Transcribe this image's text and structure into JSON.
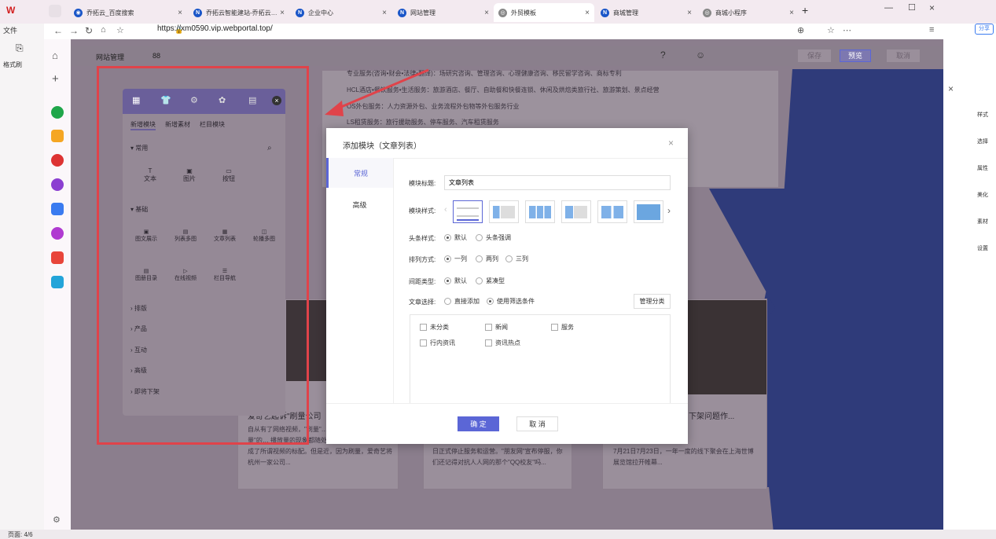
{
  "browser": {
    "tabs": [
      {
        "label": "乔拓云_百度搜索"
      },
      {
        "label": "乔拓云智能建站-乔拓云…"
      },
      {
        "label": "企业中心"
      },
      {
        "label": "网站管理"
      },
      {
        "label": "外贸模板"
      },
      {
        "label": "商城管理"
      },
      {
        "label": "商城小程序"
      }
    ],
    "url": "https://xm0590.vip.webportal.top/",
    "new_tab": "+"
  },
  "wps": {
    "menu_file": "文件",
    "format_brush": "格式刷",
    "right_tools": [
      "样式",
      "选择",
      "属性",
      "美化",
      "素材",
      "设置"
    ],
    "share": "分享",
    "status_page": "页面: 4/6"
  },
  "editor": {
    "site_manage": "网站管理",
    "grid": "88",
    "save": "保存",
    "preview": "预览",
    "cancel": "取消"
  },
  "bg_texts": {
    "l1": "专业服务(咨询•财会•法律•翻译)：场研究咨询、管理咨询、心理健康咨询、移民留学咨询、商标专利",
    "l2": "HCL酒店•餐饮服务•生活服务：旅游酒店、餐厅、自助餐和快餐连锁、休闲及烘焙类旅行社、旅游策划、景点经营",
    "l3": "OS外包服务：人力资源外包、业务流程外包物等外包服务行业",
    "l4": "LS租赁服务：旅行援助服务、停车服务、汽车租赁服务",
    "card1_title": "爱奇艺起诉\"刷量公司",
    "card1_body": "自从有了网络视频，\"刷量\"… 在这个领域\"刷流量\"的… 播放量的现象都随处可见。\"刷量\"似乎已经成了所谓视频的标配。但是近，因为刷量，爱奇艺将杭州一家公司...",
    "card2_body": "日正式停止服务和运营。\"朋友网\"宣布停服，你们还记得对抗人人网的那个\"QQ校友\"吗...",
    "card3_title": "下架问题作...",
    "card3_body": "7月21日7月23日，一年一度的线下聚会在上海世博展览馆拉开帷幕..."
  },
  "side_panel": {
    "tabs": [
      "新增模块",
      "新增素材",
      "栏目模块"
    ],
    "sections": {
      "common": "常用",
      "basic": "基础",
      "layout": "排版",
      "product": "产品",
      "interact": "互动",
      "advanced": "高级",
      "coming": "即将下架"
    },
    "common_items": [
      "文本",
      "图片",
      "按钮"
    ],
    "basic_items_row1": [
      "图文展示",
      "列表多图",
      "文章列表",
      "轮播多图"
    ],
    "basic_items_row2": [
      "图册目录",
      "在线视频",
      "栏目导航"
    ]
  },
  "dialog": {
    "title": "添加模块（文章列表）",
    "tab_general": "常规",
    "tab_advanced": "高级",
    "module_title_label": "模块标题:",
    "module_title_value": "文章列表",
    "style_label": "模块样式:",
    "headline_label": "头条样式:",
    "headline_opts": [
      "默认",
      "头条强调"
    ],
    "arrange_label": "排列方式:",
    "arrange_opts": [
      "一列",
      "两列",
      "三列"
    ],
    "spacing_label": "间距类型:",
    "spacing_opts": [
      "默认",
      "紧凑型"
    ],
    "article_label": "文章选择:",
    "article_opts": [
      "直接添加",
      "使用筛选条件"
    ],
    "manage_btn": "管理分类",
    "categories": [
      "未分类",
      "新闻",
      "服务",
      "行内资讯",
      "资讯热点"
    ],
    "ok": "确 定",
    "cancel": "取 消"
  },
  "colors": {
    "accent": "#5b66d6",
    "red_box": "#e0434a",
    "overlay": "#8b7e8d"
  }
}
